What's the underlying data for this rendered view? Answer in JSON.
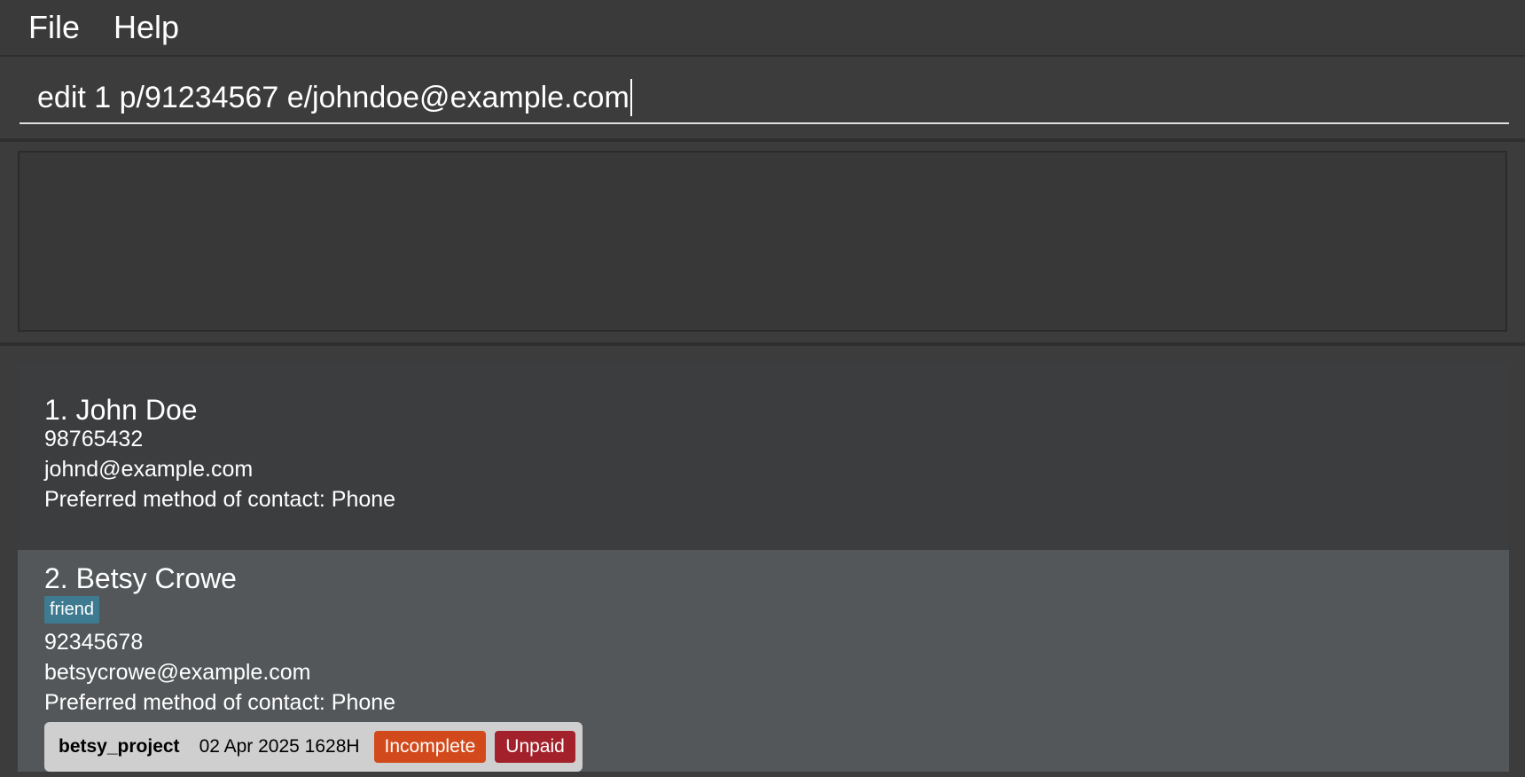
{
  "menu": {
    "file_label": "File",
    "help_label": "Help"
  },
  "command": {
    "value": "edit 1 p/91234567 e/johndoe@example.com"
  },
  "result": {
    "text": ""
  },
  "persons": [
    {
      "index_name": "1. John Doe",
      "phone": "98765432",
      "email": "johnd@example.com",
      "preferred_contact": "Preferred method of contact: Phone"
    },
    {
      "index_name": "2. Betsy Crowe",
      "tag": "friend",
      "phone": "92345678",
      "email": "betsycrowe@example.com",
      "preferred_contact": "Preferred method of contact: Phone",
      "project": {
        "name": "betsy_project",
        "deadline": "02 Apr 2025 1628H",
        "status": "Incomplete",
        "payment": "Unpaid"
      }
    }
  ],
  "colors": {
    "tag": "#3e7b91",
    "status_incomplete": "#d24a1b",
    "payment_unpaid": "#a3212b",
    "selected_card": "#535759"
  }
}
